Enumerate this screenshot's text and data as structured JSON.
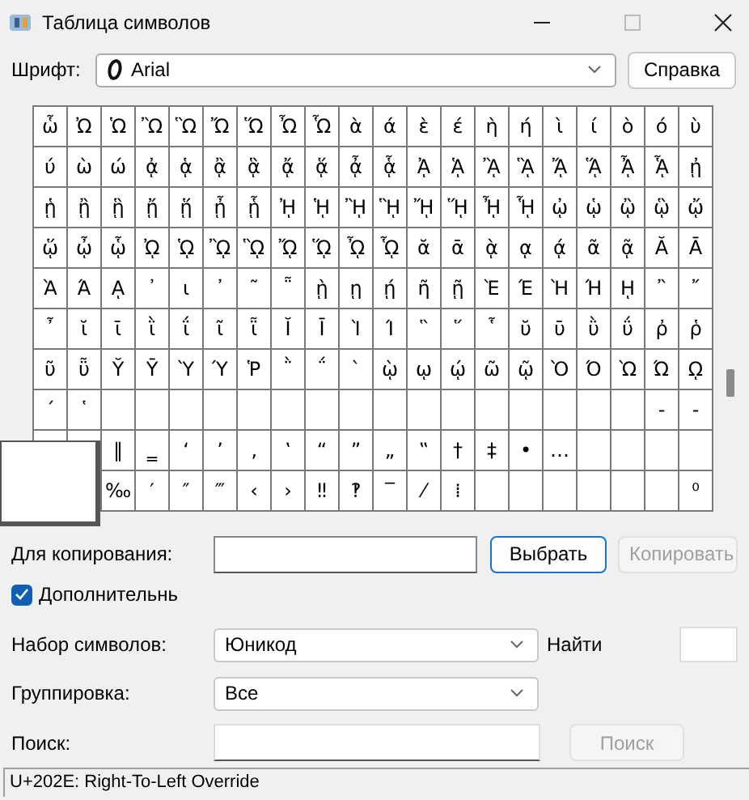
{
  "window": {
    "title": "Таблица символов"
  },
  "font": {
    "label": "Шрифт:",
    "value": "Arial"
  },
  "help_button": {
    "label": "Справка"
  },
  "grid": {
    "rows": [
      [
        "ὧ",
        "Ὠ",
        "Ὡ",
        "Ὢ",
        "Ὣ",
        "Ὤ",
        "Ὥ",
        "Ὦ",
        "Ὧ",
        "ὰ",
        "ά",
        "ὲ",
        "έ",
        "ὴ",
        "ή",
        "ὶ",
        "ί",
        "ὸ",
        "ό",
        "ὺ"
      ],
      [
        "ύ",
        "ὼ",
        "ώ",
        "ᾀ",
        "ᾁ",
        "ᾂ",
        "ᾃ",
        "ᾄ",
        "ᾅ",
        "ᾆ",
        "ᾇ",
        "ᾈ",
        "ᾉ",
        "ᾊ",
        "ᾋ",
        "ᾌ",
        "ᾍ",
        "ᾎ",
        "ᾏ",
        "ᾐ"
      ],
      [
        "ᾑ",
        "ᾒ",
        "ᾓ",
        "ᾔ",
        "ᾕ",
        "ᾖ",
        "ᾗ",
        "ᾘ",
        "ᾙ",
        "ᾚ",
        "ᾛ",
        "ᾜ",
        "ᾝ",
        "ᾞ",
        "ᾟ",
        "ᾠ",
        "ᾡ",
        "ᾢ",
        "ᾣ",
        "ᾤ"
      ],
      [
        "ᾥ",
        "ᾦ",
        "ᾧ",
        "ᾨ",
        "ᾩ",
        "ᾪ",
        "ᾫ",
        "ᾬ",
        "ᾭ",
        "ᾮ",
        "ᾯ",
        "ᾰ",
        "ᾱ",
        "ᾲ",
        "ᾳ",
        "ᾴ",
        "ᾶ",
        "ᾷ",
        "Ᾰ",
        "Ᾱ"
      ],
      [
        "Ὰ",
        "Ά",
        "ᾼ",
        "᾽",
        "ι",
        "᾿",
        "῀",
        "῁",
        "ῂ",
        "ῃ",
        "ῄ",
        "ῆ",
        "ῇ",
        "Ὲ",
        "Έ",
        "Ὴ",
        "Ή",
        "ῌ",
        "῍",
        "῎"
      ],
      [
        "῏",
        "ῐ",
        "ῑ",
        "ῒ",
        "ΐ",
        "ῖ",
        "ῗ",
        "Ῐ",
        "Ῑ",
        "Ὶ",
        "Ί",
        "῝",
        "῞",
        "῟",
        "ῠ",
        "ῡ",
        "ῢ",
        "ΰ",
        "ῤ",
        "ῥ"
      ],
      [
        "ῦ",
        "ῧ",
        "Ῠ",
        "Ῡ",
        "Ὺ",
        "Ύ",
        "Ῥ",
        "῭",
        "΅",
        "`",
        "ῲ",
        "ῳ",
        "ῴ",
        "ῶ",
        "ῷ",
        "Ὸ",
        "Ό",
        "Ὼ",
        "Ώ",
        "ῼ"
      ],
      [
        "´",
        "῾",
        null,
        null,
        null,
        null,
        null,
        null,
        null,
        null,
        null,
        null,
        null,
        null,
        null,
        null,
        null,
        null,
        "‐",
        "‑"
      ],
      [
        null,
        null,
        "‖",
        "‗",
        "‘",
        "’",
        "‚",
        "‛",
        "“",
        "”",
        "„",
        "‟",
        "†",
        "‡",
        "•",
        "…",
        null,
        null,
        null,
        null
      ],
      [
        null,
        null,
        "‰",
        "′",
        "″",
        "‴",
        "‹",
        "›",
        "‼",
        "‽",
        "‾",
        "⁄",
        "⁞",
        null,
        null,
        null,
        null,
        null,
        null,
        "⁰"
      ]
    ]
  },
  "copy": {
    "label": "Для копирования:"
  },
  "select_button": {
    "label": "Выбрать",
    "disabled": false
  },
  "copy_button": {
    "label": "Копировать",
    "disabled": true
  },
  "advanced": {
    "label": "Дополнительнь",
    "checked": true
  },
  "charset": {
    "label": "Набор символов:",
    "value": "Юникод"
  },
  "find": {
    "label": "Найти"
  },
  "grouping": {
    "label": "Группировка:",
    "value": "Все"
  },
  "search": {
    "label": "Поиск:"
  },
  "search_button": {
    "label": "Поиск",
    "disabled": true
  },
  "status_bar": {
    "text": "U+202E: Right-To-Left Override"
  }
}
